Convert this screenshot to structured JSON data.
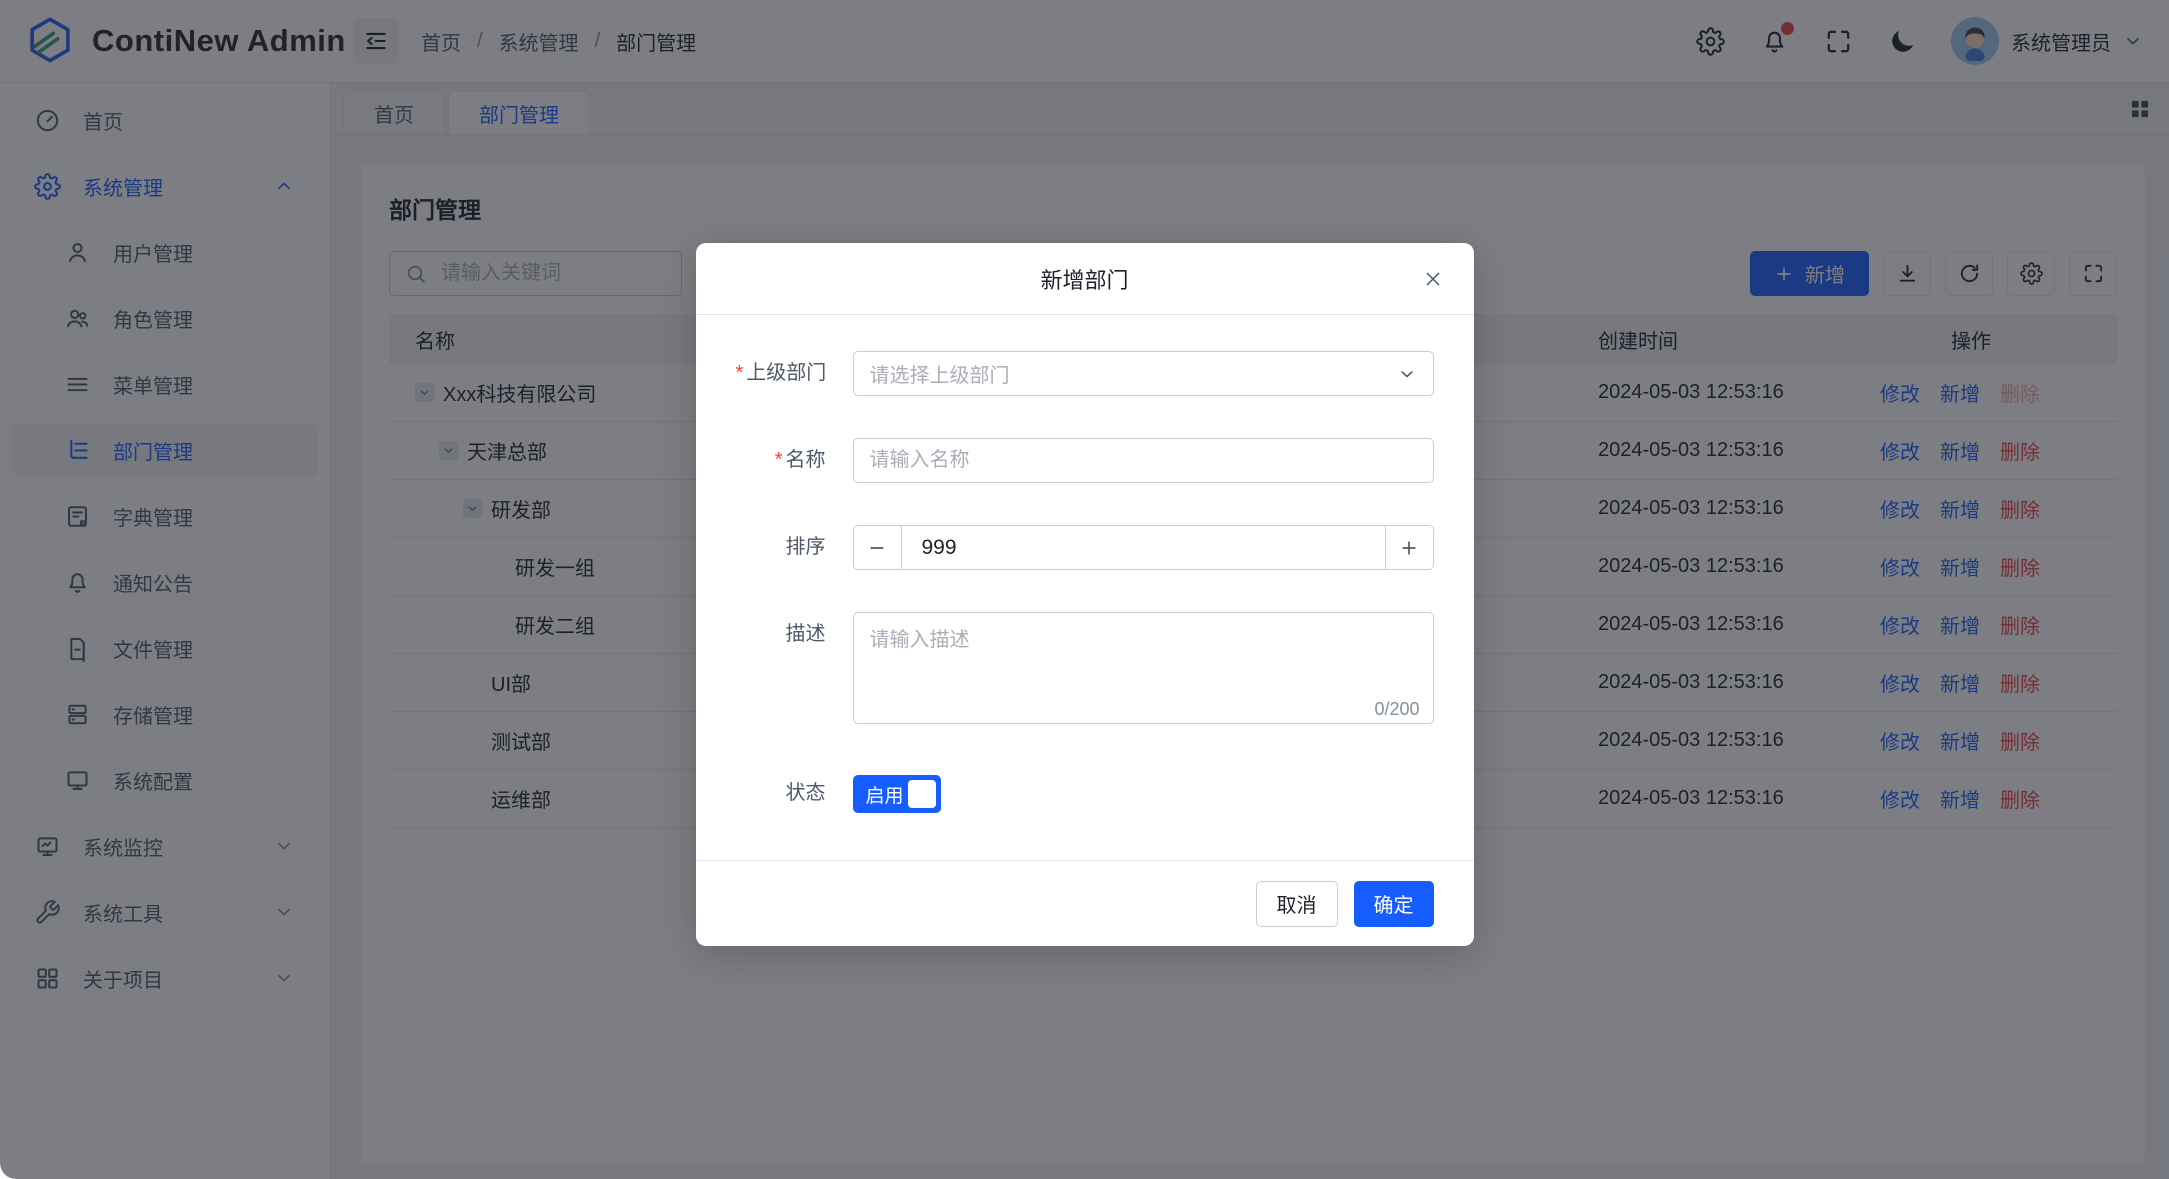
{
  "app": {
    "title": "ContiNew Admin"
  },
  "header": {
    "breadcrumb": [
      "首页",
      "系统管理",
      "部门管理"
    ],
    "separator": "/",
    "user_name": "系统管理员"
  },
  "sidebar": {
    "items": [
      {
        "id": "home",
        "label": "首页",
        "icon": "dashboard"
      },
      {
        "id": "system-management",
        "label": "系统管理",
        "icon": "gear",
        "expanded": true,
        "active_parent": true,
        "children": [
          {
            "id": "user-management",
            "label": "用户管理",
            "icon": "user"
          },
          {
            "id": "role-management",
            "label": "角色管理",
            "icon": "users"
          },
          {
            "id": "menu-management",
            "label": "菜单管理",
            "icon": "list"
          },
          {
            "id": "department-management",
            "label": "部门管理",
            "icon": "tree",
            "active": true
          },
          {
            "id": "dict-management",
            "label": "字典管理",
            "icon": "book"
          },
          {
            "id": "notice",
            "label": "通知公告",
            "icon": "bell"
          },
          {
            "id": "file-management",
            "label": "文件管理",
            "icon": "file"
          },
          {
            "id": "storage-management",
            "label": "存储管理",
            "icon": "server"
          },
          {
            "id": "system-config",
            "label": "系统配置",
            "icon": "monitor"
          }
        ]
      },
      {
        "id": "system-monitor",
        "label": "系统监控",
        "icon": "monitor-chart",
        "expanded": false,
        "children": []
      },
      {
        "id": "system-tools",
        "label": "系统工具",
        "icon": "wrench",
        "expanded": false,
        "children": []
      },
      {
        "id": "about-project",
        "label": "关于项目",
        "icon": "grid",
        "expanded": false,
        "children": []
      }
    ]
  },
  "tabs": {
    "items": [
      {
        "label": "首页",
        "active": false
      },
      {
        "label": "部门管理",
        "active": true
      }
    ]
  },
  "page": {
    "title": "部门管理",
    "search_placeholder": "请输入关键词",
    "toolbar": {
      "add_label": "新增"
    }
  },
  "table": {
    "columns": {
      "name": "名称",
      "created": "创建时间",
      "actions": "操作"
    },
    "action_labels": {
      "edit": "修改",
      "add": "新增",
      "delete": "删除"
    },
    "rows": [
      {
        "name": "Xxx科技有限公司",
        "level": 0,
        "expandable": true,
        "created": "2024-05-03 12:53:16",
        "delete_disabled": true
      },
      {
        "name": "天津总部",
        "level": 1,
        "expandable": true,
        "created": "2024-05-03 12:53:16",
        "delete_disabled": false
      },
      {
        "name": "研发部",
        "level": 2,
        "expandable": true,
        "created": "2024-05-03 12:53:16",
        "delete_disabled": false
      },
      {
        "name": "研发一组",
        "level": 3,
        "expandable": false,
        "created": "2024-05-03 12:53:16",
        "delete_disabled": false
      },
      {
        "name": "研发二组",
        "level": 3,
        "expandable": false,
        "created": "2024-05-03 12:53:16",
        "delete_disabled": false
      },
      {
        "name": "UI部",
        "level": 2,
        "expandable": false,
        "created": "2024-05-03 12:53:16",
        "delete_disabled": false
      },
      {
        "name": "测试部",
        "level": 2,
        "expandable": false,
        "created": "2024-05-03 12:53:16",
        "delete_disabled": false
      },
      {
        "name": "运维部",
        "level": 2,
        "expandable": false,
        "created": "2024-05-03 12:53:16",
        "delete_disabled": false
      }
    ]
  },
  "modal": {
    "title": "新增部门",
    "required_mark": "*",
    "fields": {
      "parent": {
        "label": "上级部门",
        "placeholder": "请选择上级部门",
        "required": true
      },
      "name": {
        "label": "名称",
        "placeholder": "请输入名称",
        "required": true
      },
      "sort": {
        "label": "排序",
        "value": "999"
      },
      "description": {
        "label": "描述",
        "placeholder": "请输入描述",
        "counter": "0/200"
      },
      "status": {
        "label": "状态",
        "on_label": "启用",
        "enabled": true
      }
    },
    "footer": {
      "cancel_label": "取消",
      "ok_label": "确定"
    }
  },
  "colors": {
    "primary": "#165DFF",
    "danger": "#F53F3F"
  }
}
